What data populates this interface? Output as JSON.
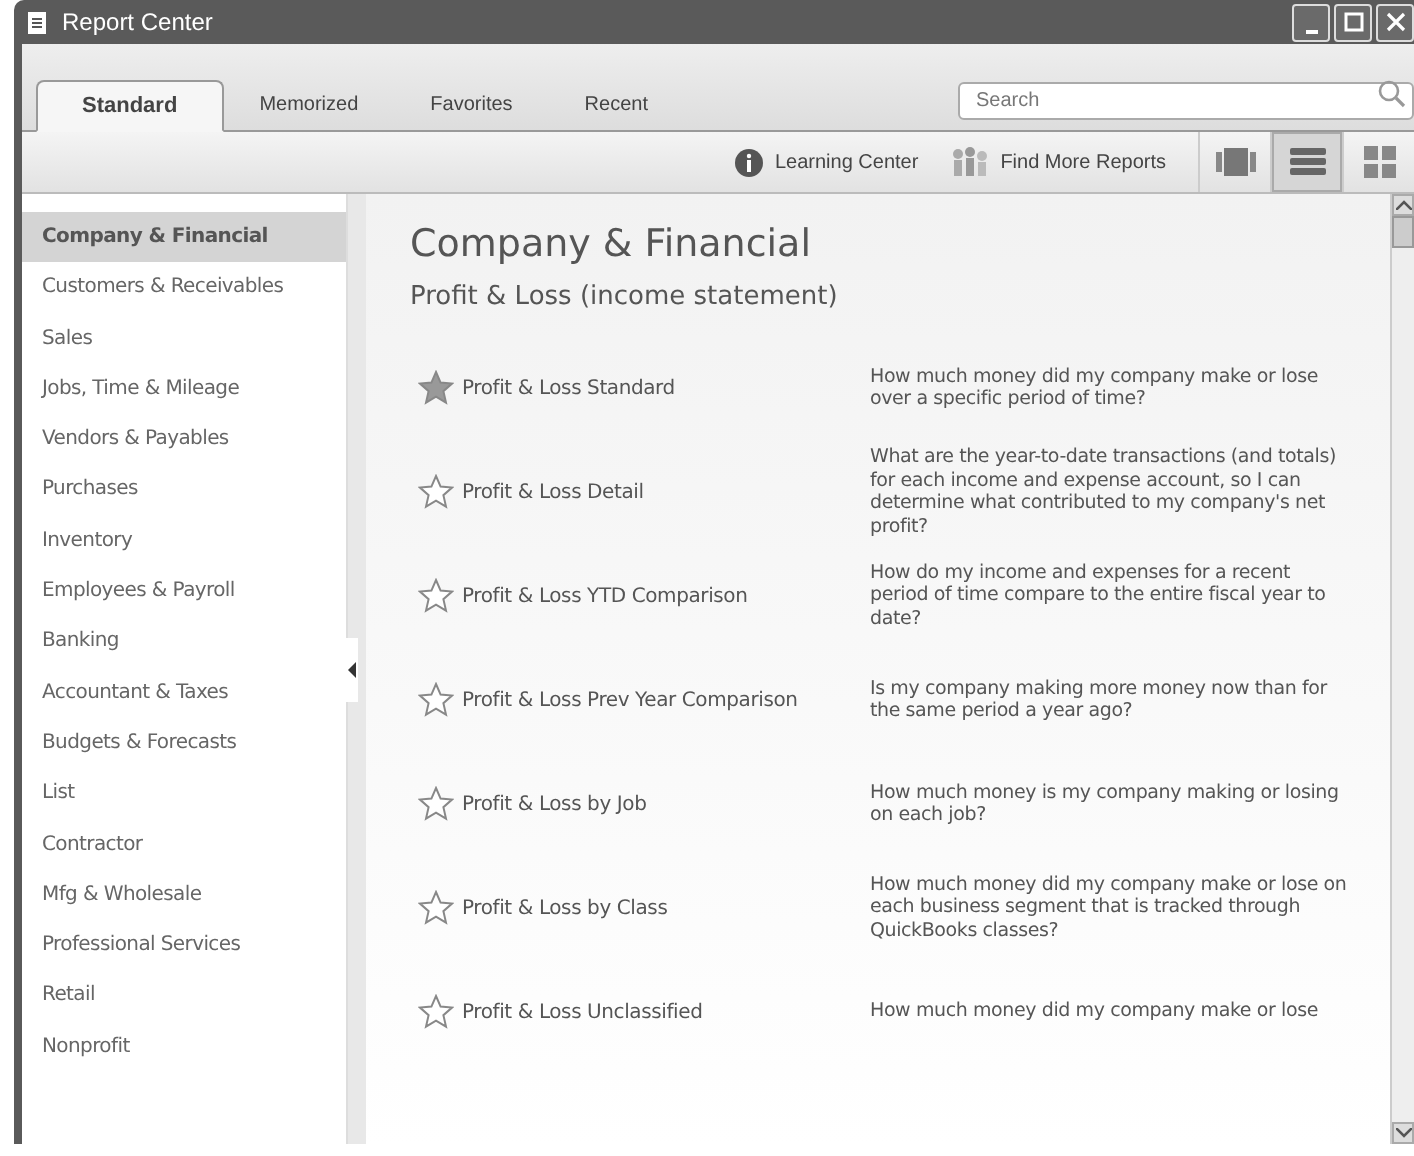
{
  "window": {
    "title": "Report Center"
  },
  "tabs": [
    {
      "label": "Standard",
      "selected": true
    },
    {
      "label": "Memorized",
      "selected": false
    },
    {
      "label": "Favorites",
      "selected": false
    },
    {
      "label": "Recent",
      "selected": false
    }
  ],
  "search": {
    "placeholder": "Search"
  },
  "toolbar": {
    "links": [
      {
        "kind": "info",
        "label": "Learning Center"
      },
      {
        "kind": "people",
        "label": "Find More Reports"
      }
    ],
    "views": [
      {
        "kind": "carousel",
        "selected": false
      },
      {
        "kind": "list",
        "selected": true
      },
      {
        "kind": "grid",
        "selected": false
      }
    ]
  },
  "sidebar": {
    "items": [
      {
        "label": "Company & Financial",
        "selected": true
      },
      {
        "label": "Customers & Receivables",
        "selected": false
      },
      {
        "label": "Sales",
        "selected": false
      },
      {
        "label": "Jobs, Time & Mileage",
        "selected": false
      },
      {
        "label": "Vendors & Payables",
        "selected": false
      },
      {
        "label": "Purchases",
        "selected": false
      },
      {
        "label": "Inventory",
        "selected": false
      },
      {
        "label": "Employees & Payroll",
        "selected": false
      },
      {
        "label": "Banking",
        "selected": false
      },
      {
        "label": "Accountant & Taxes",
        "selected": false
      },
      {
        "label": "Budgets & Forecasts",
        "selected": false
      },
      {
        "label": "List",
        "selected": false
      },
      {
        "label": "Contractor",
        "selected": false
      },
      {
        "label": "Mfg & Wholesale",
        "selected": false
      },
      {
        "label": "Professional Services",
        "selected": false
      },
      {
        "label": "Retail",
        "selected": false
      },
      {
        "label": "Nonprofit",
        "selected": false
      }
    ]
  },
  "content": {
    "title": "Company & Financial",
    "section": "Profit & Loss (income statement)",
    "reports": [
      {
        "name": "Profit & Loss Standard",
        "favorite": true,
        "description": "How much money did my company make or lose over a specific period of time?"
      },
      {
        "name": "Profit & Loss Detail",
        "favorite": false,
        "description": "What are the year-to-date transactions (and totals) for each income and expense account, so I can determine what contributed to my company's net profit?"
      },
      {
        "name": "Profit & Loss YTD Comparison",
        "favorite": false,
        "description": "How do my income and expenses for a recent period of time compare to the entire fiscal year to date?"
      },
      {
        "name": "Profit & Loss Prev Year Comparison",
        "favorite": false,
        "description": "Is my company making more money now than for the same period a year ago?"
      },
      {
        "name": "Profit & Loss by Job",
        "favorite": false,
        "description": "How much money is my company making or losing on each job?"
      },
      {
        "name": "Profit & Loss by Class",
        "favorite": false,
        "description": "How much money did my company make or lose on  each business segment that is tracked through QuickBooks classes?"
      },
      {
        "name": "Profit & Loss Unclassified",
        "favorite": false,
        "description": "How much money did my company make or lose"
      }
    ]
  }
}
